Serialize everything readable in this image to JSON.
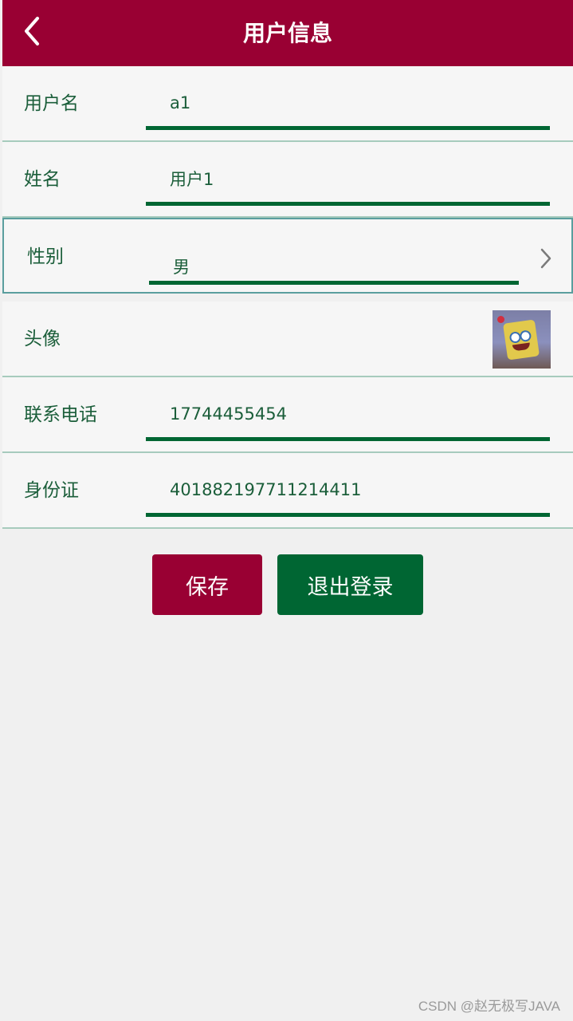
{
  "colors": {
    "brand": "#990033",
    "accent": "#006633",
    "label": "#1b5e3a",
    "row_background": "#f6f6f6",
    "page_background": "#f0f0f0"
  },
  "header": {
    "title": "用户信息",
    "back_icon": "chevron-left-icon"
  },
  "form": {
    "username": {
      "label": "用户名",
      "value": "a1"
    },
    "name": {
      "label": "姓名",
      "value": "用户1"
    },
    "gender": {
      "label": "性别",
      "value": "男",
      "icon": "chevron-right-icon"
    },
    "avatar": {
      "label": "头像",
      "image": "avatar-image"
    },
    "phone": {
      "label": "联系电话",
      "value": "17744455454"
    },
    "id_card": {
      "label": "身份证",
      "value": "401882197711214411"
    }
  },
  "actions": {
    "save_label": "保存",
    "logout_label": "退出登录"
  },
  "watermark": "CSDN @赵无极写JAVA"
}
